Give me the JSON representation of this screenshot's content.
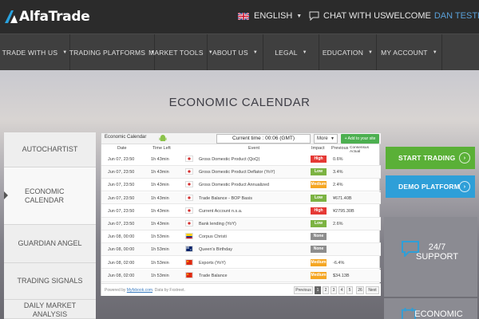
{
  "brand": {
    "name": "AlfaTrade"
  },
  "topbar": {
    "language": "ENGLISH",
    "chat": "CHAT WITH US",
    "welcome": "WELCOME",
    "user": "DAN TESTER"
  },
  "nav": [
    {
      "label": "TRADE WITH US"
    },
    {
      "label": "TRADING PLATFORMS"
    },
    {
      "label": "MARKET TOOLS"
    },
    {
      "label": "ABOUT US"
    },
    {
      "label": "LEGAL"
    },
    {
      "label": "EDUCATION"
    },
    {
      "label": "MY ACCOUNT"
    }
  ],
  "page": {
    "title": "ECONOMIC CALENDAR"
  },
  "sidebar": [
    {
      "label": "AUTOCHARTIST"
    },
    {
      "label": "ECONOMIC\nCALENDAR"
    },
    {
      "label": "GUARDIAN ANGEL"
    },
    {
      "label": "TRADING SIGNALS"
    },
    {
      "label": "DAILY MARKET\nANALYSIS"
    }
  ],
  "widget": {
    "title": "Economic Calendar",
    "current_time": "Current time : 00:06 (GMT)",
    "more": "More",
    "add": "+ Add to your site",
    "columns": {
      "date": "Date",
      "time_left": "Time Left",
      "event": "Event",
      "impact": "Impact",
      "previous": "Previous",
      "consensus": "Consensus Actual"
    },
    "rows": [
      {
        "date": "Jun 07, 23:50",
        "left": "1h 43min",
        "flag": "jp",
        "event": "Gross Domestic Product (QoQ)",
        "impact": "High",
        "prev": "0.6%"
      },
      {
        "date": "Jun 07, 23:50",
        "left": "1h 43min",
        "flag": "jp",
        "event": "Gross Domestic Product Deflator (YoY)",
        "impact": "Low",
        "prev": "3.4%"
      },
      {
        "date": "Jun 07, 23:50",
        "left": "1h 43min",
        "flag": "jp",
        "event": "Gross Domestic Product Annualized",
        "impact": "Medium",
        "prev": "2.4%"
      },
      {
        "date": "Jun 07, 23:50",
        "left": "1h 43min",
        "flag": "jp",
        "event": "Trade Balance - BOP Basis",
        "impact": "Low",
        "prev": "¥671.40B"
      },
      {
        "date": "Jun 07, 23:50",
        "left": "1h 43min",
        "flag": "jp",
        "event": "Current Account n.s.a.",
        "impact": "High",
        "prev": "¥2795.30B"
      },
      {
        "date": "Jun 07, 23:50",
        "left": "1h 43min",
        "flag": "jp",
        "event": "Bank lending (YoY)",
        "impact": "Low",
        "prev": "2.6%"
      },
      {
        "date": "Jun 08, 00:00",
        "left": "1h 53min",
        "flag": "co",
        "event": "Corpus Christi",
        "impact": "None",
        "prev": ""
      },
      {
        "date": "Jun 08, 00:00",
        "left": "1h 53min",
        "flag": "au",
        "event": "Queen's Birthday",
        "impact": "None",
        "prev": ""
      },
      {
        "date": "Jun 08, 02:00",
        "left": "1h 53min",
        "flag": "cn",
        "event": "Exports (YoY)",
        "impact": "Medium",
        "prev": "-6.4%"
      },
      {
        "date": "Jun 08, 02:00",
        "left": "1h 53min",
        "flag": "cn",
        "event": "Trade Balance",
        "impact": "Medium",
        "prev": "$34.13B"
      }
    ],
    "powered_prefix": "Powered by",
    "powered_link": "Myfxbook.com",
    "powered_suffix": ". Data by Fxstreet.",
    "pager": {
      "prev": "Previous",
      "pages": [
        "1",
        "2",
        "3",
        "4",
        "5",
        "...",
        "26"
      ],
      "next": "Next"
    }
  },
  "impact_colors": {
    "High": "#e53935",
    "Medium": "#f5a623",
    "Low": "#7cb342",
    "None": "#8d8d8d"
  },
  "cta": {
    "start": "START TRADING",
    "demo": "DEMO PLATFORM"
  },
  "tiles": [
    {
      "label": "24/7\nSUPPORT",
      "icon": "chat-bubble-icon"
    },
    {
      "label": "ECONOMIC",
      "icon": "calendar-icon"
    }
  ],
  "colors": {
    "start": "#5ab037",
    "demo": "#2e9fd8"
  }
}
